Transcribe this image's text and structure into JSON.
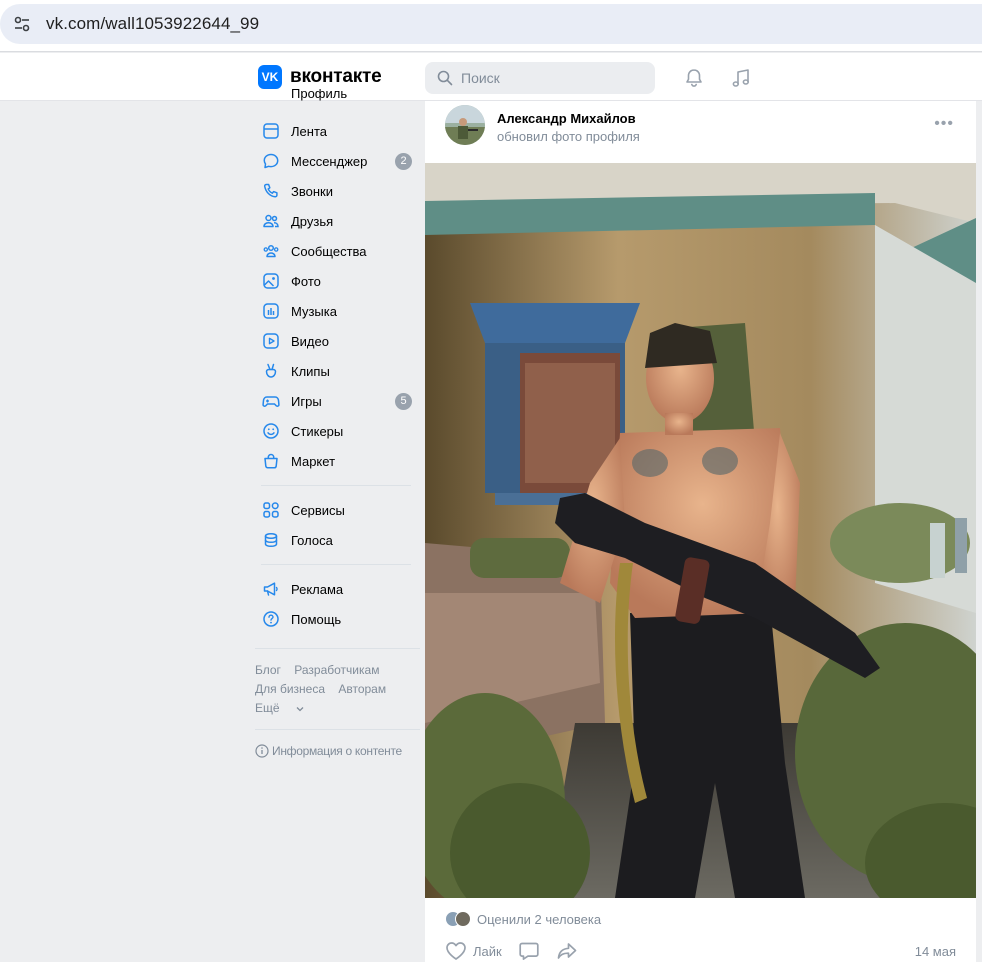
{
  "browser": {
    "url": "vk.com/wall1053922644_99",
    "site_icon": "tune-icon"
  },
  "header": {
    "logo_mark": "VK",
    "logo_text": "вконтакте",
    "search_placeholder": "Поиск",
    "icons": [
      "bell-icon",
      "music-note-icon"
    ],
    "accent": "#0077ff"
  },
  "sidebar": {
    "partial_top_label": "Профиль",
    "items": [
      {
        "label": "Лента",
        "icon": "feed-icon"
      },
      {
        "label": "Мессенджер",
        "icon": "message-bubble-icon",
        "badge": "2"
      },
      {
        "label": "Звонки",
        "icon": "phone-icon"
      },
      {
        "label": "Друзья",
        "icon": "friends-icon"
      },
      {
        "label": "Сообщества",
        "icon": "communities-icon"
      },
      {
        "label": "Фото",
        "icon": "photo-icon"
      },
      {
        "label": "Музыка",
        "icon": "music-icon"
      },
      {
        "label": "Видео",
        "icon": "video-icon"
      },
      {
        "label": "Клипы",
        "icon": "clips-icon"
      },
      {
        "label": "Игры",
        "icon": "gamepad-icon",
        "badge": "5"
      },
      {
        "label": "Стикеры",
        "icon": "smile-icon"
      },
      {
        "label": "Маркет",
        "icon": "bag-icon"
      }
    ],
    "items2": [
      {
        "label": "Сервисы",
        "icon": "grid-icon"
      },
      {
        "label": "Голоса",
        "icon": "coins-icon"
      }
    ],
    "items3": [
      {
        "label": "Реклама",
        "icon": "megaphone-icon"
      },
      {
        "label": "Помощь",
        "icon": "help-icon"
      }
    ],
    "footer_links": {
      "blog": "Блог",
      "developers": "Разработчикам",
      "business": "Для бизнеса",
      "authors": "Авторам",
      "more": "Ещё"
    },
    "info_link": "Информация о контенте"
  },
  "post": {
    "author": "Александр Михайлов",
    "action": "обновил фото профиля",
    "likes_text": "Оценили 2 человека",
    "like_label": "Лайк",
    "date": "14 мая"
  }
}
